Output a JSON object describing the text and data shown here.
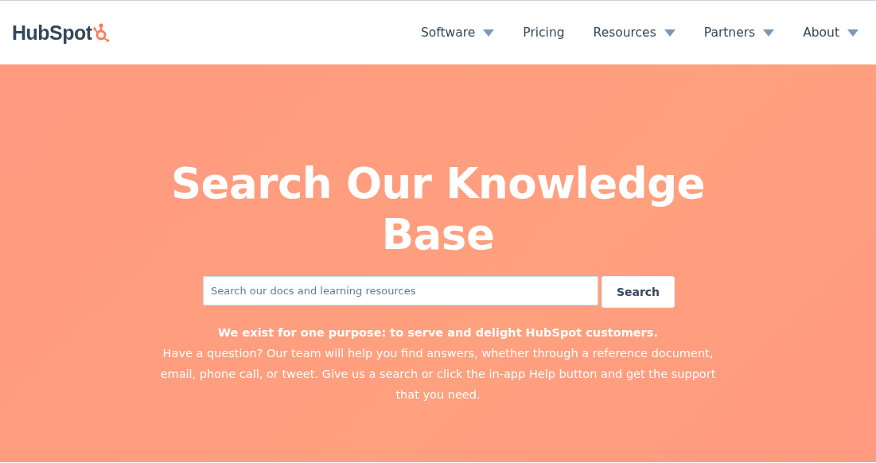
{
  "header": {
    "logo": "HubSpot",
    "nav": [
      {
        "label": "Software",
        "dropdown": true
      },
      {
        "label": "Pricing",
        "dropdown": false
      },
      {
        "label": "Resources",
        "dropdown": true
      },
      {
        "label": "Partners",
        "dropdown": true
      },
      {
        "label": "About",
        "dropdown": true
      }
    ]
  },
  "hero": {
    "title": "Search Our Knowledge Base",
    "search": {
      "placeholder": "Search our docs and learning resources",
      "button": "Search"
    },
    "intro": "**We exist for one purpose: to serve and delight HubSpot customers.**\nHave a question? Our team will help you find answers, whether through a reference document, email, phone call, or tweet. Give us a search or click the in-app Help button and get the support that you need."
  }
}
